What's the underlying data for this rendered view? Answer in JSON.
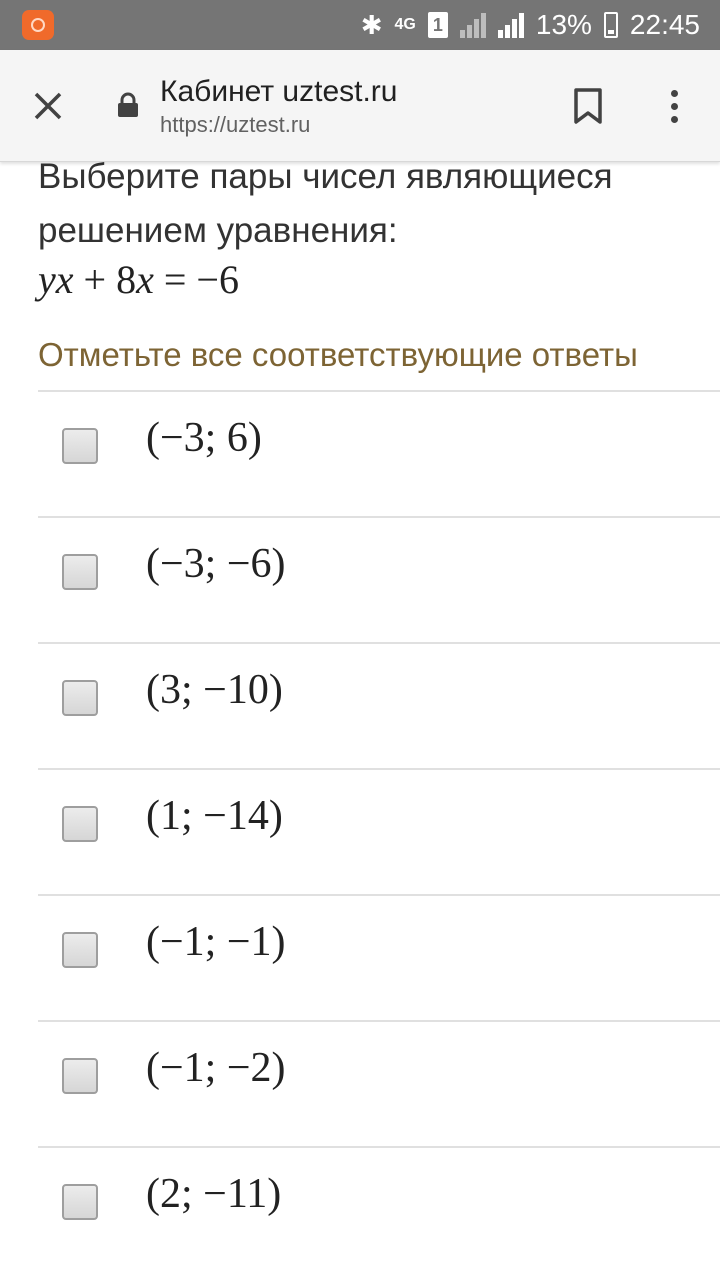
{
  "status_bar": {
    "network": "4G",
    "sim": "1",
    "battery": "13%",
    "time": "22:45"
  },
  "toolbar": {
    "title": "Кабинет uztest.ru",
    "url": "https://uztest.ru"
  },
  "question": {
    "text": "Выберите пары чисел являющиеся решением уравнения:",
    "equation": "yx + 8x = −6",
    "instruction": "Отметьте все соответствующие ответы"
  },
  "options": [
    {
      "label": "(−3; 6)",
      "checked": false
    },
    {
      "label": "(−3; −6)",
      "checked": false
    },
    {
      "label": "(3; −10)",
      "checked": false
    },
    {
      "label": "(1; −14)",
      "checked": false
    },
    {
      "label": "(−1; −1)",
      "checked": false
    },
    {
      "label": "(−1; −2)",
      "checked": false
    },
    {
      "label": "(2; −11)",
      "checked": false
    }
  ],
  "colors": {
    "status_bar": "#757575",
    "toolbar": "#f5f5f5",
    "instruction": "#7d6434"
  }
}
